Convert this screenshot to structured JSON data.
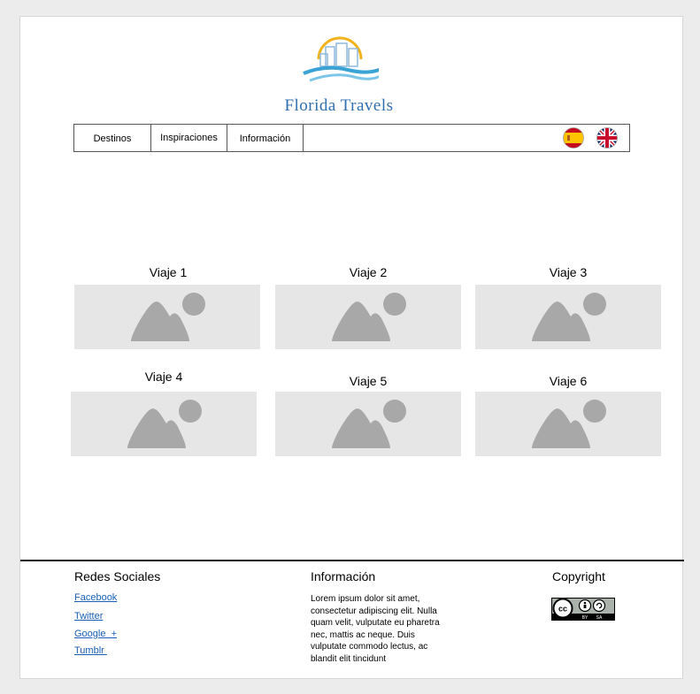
{
  "brand": {
    "name": "Florida Travels"
  },
  "nav": {
    "items": [
      {
        "label": "Destinos"
      },
      {
        "label": "Inspiraciones"
      },
      {
        "label": "Información"
      }
    ],
    "languages": [
      {
        "icon": "spain-flag-icon"
      },
      {
        "icon": "uk-flag-icon"
      }
    ]
  },
  "trips": [
    {
      "title": "Viaje 1",
      "icon": "image-placeholder-icon"
    },
    {
      "title": "Viaje 2",
      "icon": "image-placeholder-icon"
    },
    {
      "title": "Viaje 3",
      "icon": "image-placeholder-icon"
    },
    {
      "title": "Viaje 4",
      "icon": "image-placeholder-icon"
    },
    {
      "title": "Viaje 5",
      "icon": "image-placeholder-icon"
    },
    {
      "title": "Viaje 6",
      "icon": "image-placeholder-icon"
    }
  ],
  "footer": {
    "social": {
      "heading": "Redes Sociales",
      "links": [
        "Facebook",
        "Twitter",
        "Google  +",
        "Tumblr "
      ]
    },
    "info": {
      "heading": "Información",
      "text": "Lorem ipsum dolor sit amet, consectetur adipiscing elit. Nulla quam velit, vulputate eu pharetra nec, mattis ac neque. Duis vulputate commodo lectus, ac blandit elit tincidunt"
    },
    "copyright": {
      "heading": "Copyright",
      "badge": {
        "left": "BY",
        "right": "SA"
      }
    }
  },
  "colors": {
    "brand_blue": "#2f6fb0",
    "sun_yellow": "#f2b21c",
    "placeholder_bg": "#e6e6e6",
    "placeholder_icon": "#a8a8a8",
    "link_blue": "#1a5fb4"
  }
}
